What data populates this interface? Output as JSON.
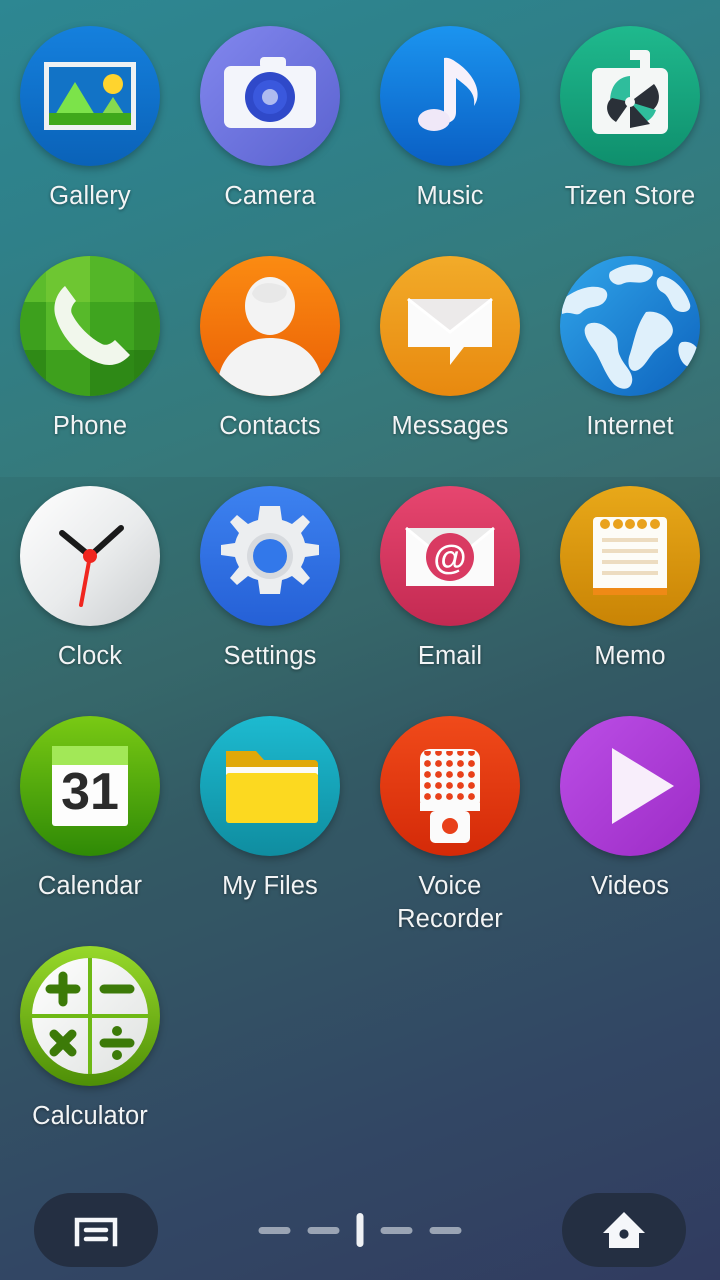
{
  "screen": {
    "title": "App Launcher",
    "background_top_color": "#2d8792",
    "background_bottom_color": "#343f66"
  },
  "apps": [
    {
      "label": "Gallery",
      "icon": "gallery-icon",
      "color": "#0a6fce"
    },
    {
      "label": "Camera",
      "icon": "camera-icon",
      "color": "#6c72de"
    },
    {
      "label": "Music",
      "icon": "music-note-icon",
      "color": "#0b7fe0"
    },
    {
      "label": "Tizen Store",
      "icon": "tizen-store-icon",
      "color": "#17a57f"
    },
    {
      "label": "Phone",
      "icon": "phone-handset-icon",
      "color": "#3faa28"
    },
    {
      "label": "Contacts",
      "icon": "contacts-person-icon",
      "color": "#f47309"
    },
    {
      "label": "Messages",
      "icon": "message-bubble-icon",
      "color": "#eda022"
    },
    {
      "label": "Internet",
      "icon": "globe-icon",
      "color": "#1684d4"
    },
    {
      "label": "Clock",
      "icon": "analog-clock-icon",
      "color": "#e9eaec"
    },
    {
      "label": "Settings",
      "icon": "gear-icon",
      "color": "#2f6fe4"
    },
    {
      "label": "Email",
      "icon": "email-at-icon",
      "color": "#d93a62"
    },
    {
      "label": "Memo",
      "icon": "memo-notepad-icon",
      "color": "#d79a0d"
    },
    {
      "label": "Calendar",
      "icon": "calendar-31-icon",
      "color": "#54a812"
    },
    {
      "label": "My Files",
      "icon": "folder-icon",
      "color": "#16a3b8"
    },
    {
      "label": "Voice\nRecorder",
      "icon": "microphone-icon",
      "color": "#ea3b16"
    },
    {
      "label": "Videos",
      "icon": "play-triangle-icon",
      "color": "#ab3ad4"
    },
    {
      "label": "Calculator",
      "icon": "calculator-icon",
      "color": "#7ac51b"
    }
  ],
  "calendar_icon_day": "31",
  "bottom_bar": {
    "menu_key_name": "menu-recents-key",
    "menu_key_icon": "menu-window-icon",
    "home_key_name": "home-key",
    "home_key_icon": "home-house-icon",
    "page_indicator": {
      "total_pages": 5,
      "current_page": 3
    }
  }
}
